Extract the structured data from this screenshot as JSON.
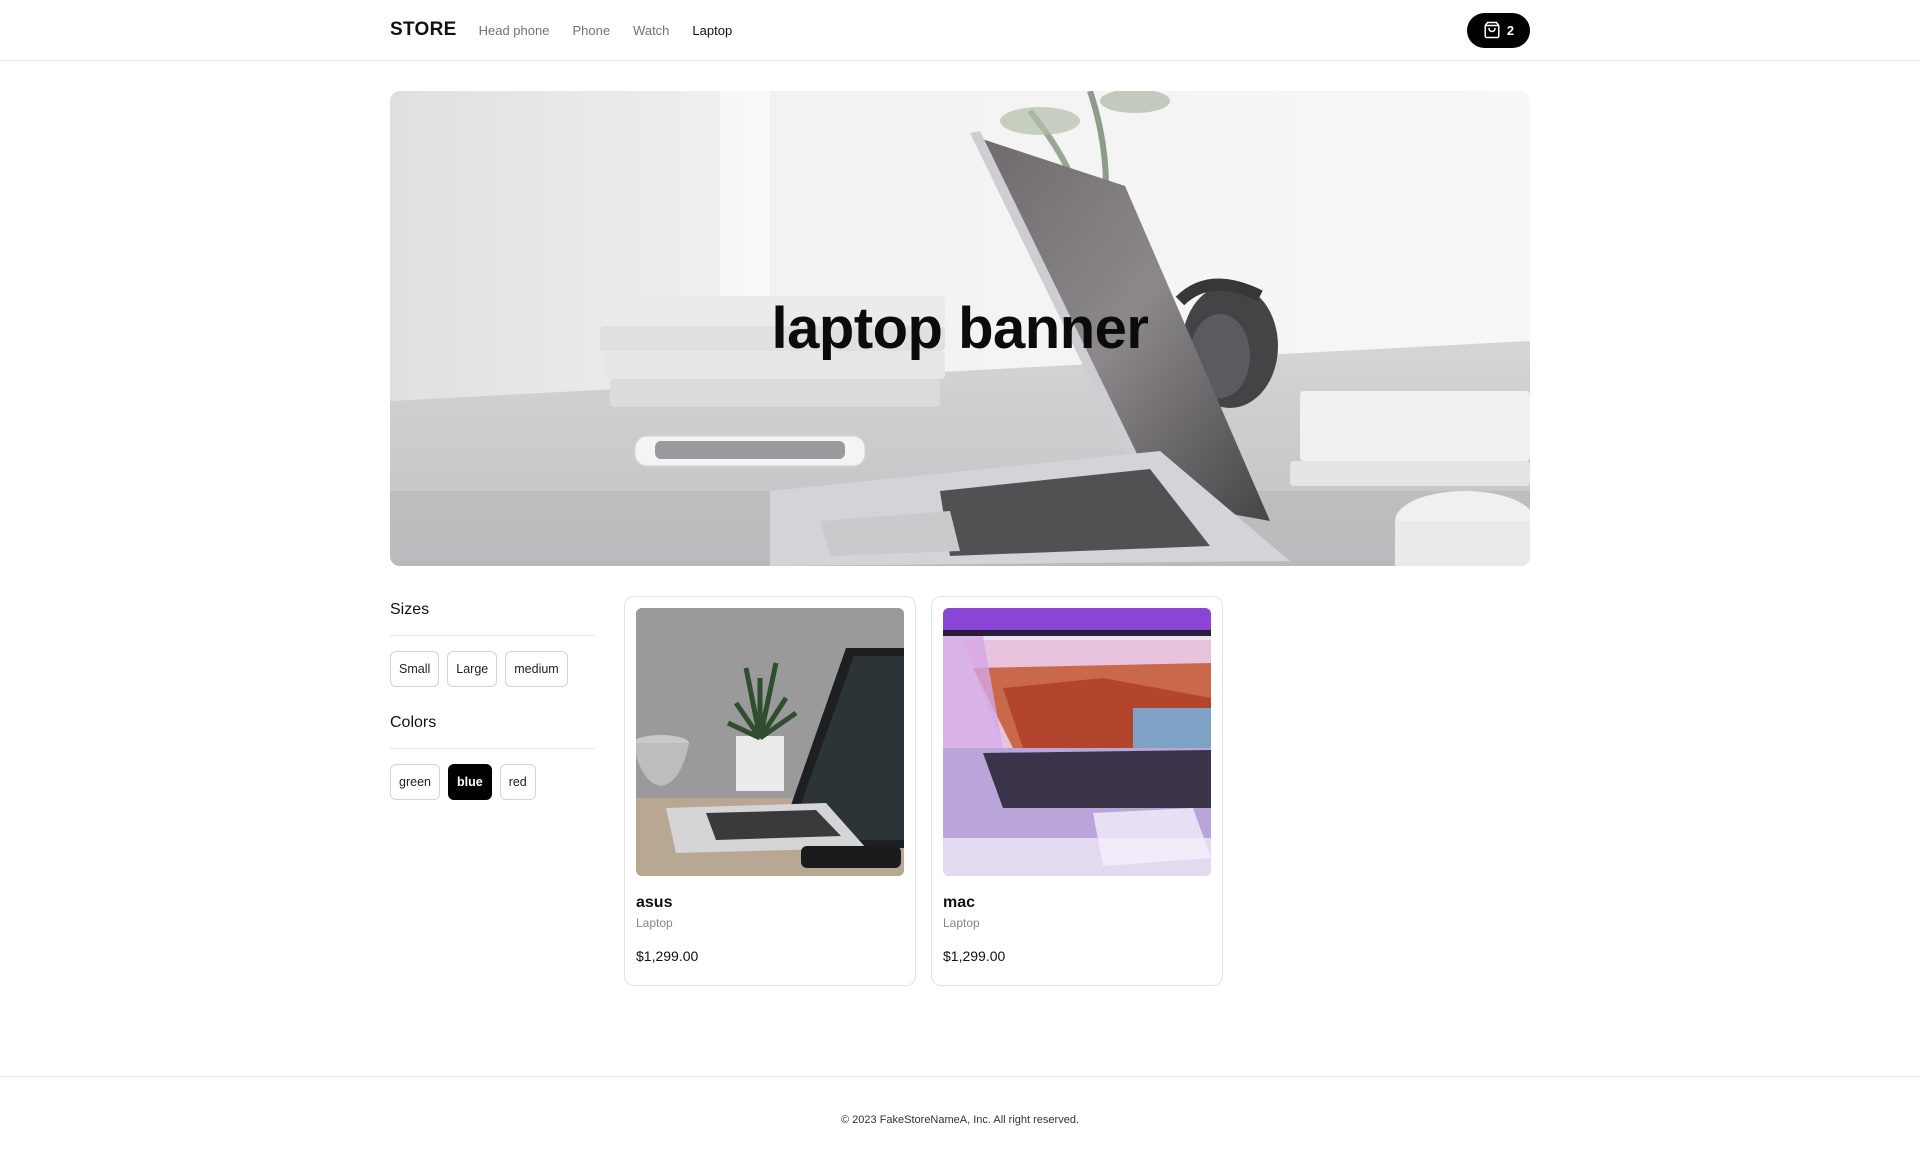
{
  "header": {
    "logo": "STORE",
    "nav": [
      {
        "label": "Head phone",
        "active": false
      },
      {
        "label": "Phone",
        "active": false
      },
      {
        "label": "Watch",
        "active": false
      },
      {
        "label": "Laptop",
        "active": true
      }
    ],
    "cart": {
      "icon": "shopping-bag-icon",
      "count": "2"
    }
  },
  "banner": {
    "title": "laptop banner"
  },
  "filters": {
    "sizes": {
      "title": "Sizes",
      "options": [
        {
          "label": "Small",
          "selected": false
        },
        {
          "label": "Large",
          "selected": false
        },
        {
          "label": "medium",
          "selected": false
        }
      ]
    },
    "colors": {
      "title": "Colors",
      "options": [
        {
          "label": "green",
          "selected": false
        },
        {
          "label": "blue",
          "selected": true
        },
        {
          "label": "red",
          "selected": false
        }
      ]
    }
  },
  "products": [
    {
      "name": "asus",
      "category": "Laptop",
      "price": "$1,299.00"
    },
    {
      "name": "mac",
      "category": "Laptop",
      "price": "$1,299.00"
    }
  ],
  "footer": {
    "copyright": "© 2023 FakeStoreNameA, Inc. All right reserved."
  },
  "theme": {
    "accent": "#000000",
    "border": "#e3e3e3",
    "muted_text": "#737373"
  }
}
